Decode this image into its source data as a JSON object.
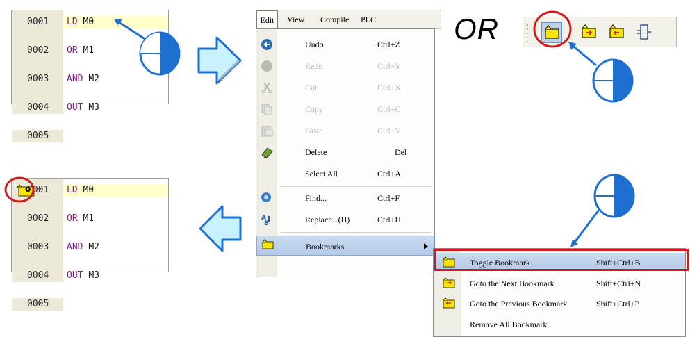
{
  "listing_before": {
    "lines": [
      {
        "num": "0001",
        "op": "LD",
        "arg": "M0"
      },
      {
        "num": "0002",
        "op": "OR",
        "arg": "M1"
      },
      {
        "num": "0003",
        "op": "AND",
        "arg": "M2"
      },
      {
        "num": "0004",
        "op": "OUT",
        "arg": "M3"
      },
      {
        "num": "0005",
        "op": "",
        "arg": ""
      }
    ]
  },
  "listing_after": {
    "lines": [
      {
        "num": "0001",
        "op": "LD",
        "arg": "M0"
      },
      {
        "num": "0002",
        "op": "OR",
        "arg": "M1"
      },
      {
        "num": "0003",
        "op": "AND",
        "arg": "M2"
      },
      {
        "num": "0004",
        "op": "OUT",
        "arg": "M3"
      },
      {
        "num": "0005",
        "op": "",
        "arg": ""
      }
    ]
  },
  "menubar": {
    "edit": "Edit",
    "view": "View",
    "compile": "Compile",
    "plc": "PLC"
  },
  "edit_menu": {
    "undo": {
      "label": "Undo",
      "shortcut": "Ctrl+Z"
    },
    "redo": {
      "label": "Redo",
      "shortcut": "Ctrl+Y"
    },
    "cut": {
      "label": "Cut",
      "shortcut": "Ctrl+X"
    },
    "copy": {
      "label": "Copy",
      "shortcut": "Ctrl+C"
    },
    "paste": {
      "label": "Paste",
      "shortcut": "Ctrl+V"
    },
    "delete": {
      "label": "Delete",
      "shortcut": "Del"
    },
    "select_all": {
      "label": "Select All",
      "shortcut": "Ctrl+A"
    },
    "find": {
      "label": "Find...",
      "shortcut": "Ctrl+F"
    },
    "replace": {
      "label": "Replace...(H)",
      "shortcut": "Ctrl+H"
    },
    "bookmarks": {
      "label": "Bookmarks"
    }
  },
  "bookmarks_submenu": {
    "toggle": {
      "label": "Toggle Bookmark",
      "shortcut": "Shift+Ctrl+B"
    },
    "next": {
      "label": "Goto the Next Bookmark",
      "shortcut": "Shift+Ctrl+N"
    },
    "previous": {
      "label": "Goto the Previous Bookmark",
      "shortcut": "Shift+Ctrl+P"
    },
    "remove_all": {
      "label": "Remove All Bookmark"
    }
  },
  "or_text": "OR",
  "bookmark_marker": "o",
  "colors": {
    "arrow_fill": "#c8f2ff",
    "arrow_stroke": "#1f6fd0",
    "highlight": "#d11a1a",
    "keyword": "#8b1a8b"
  }
}
